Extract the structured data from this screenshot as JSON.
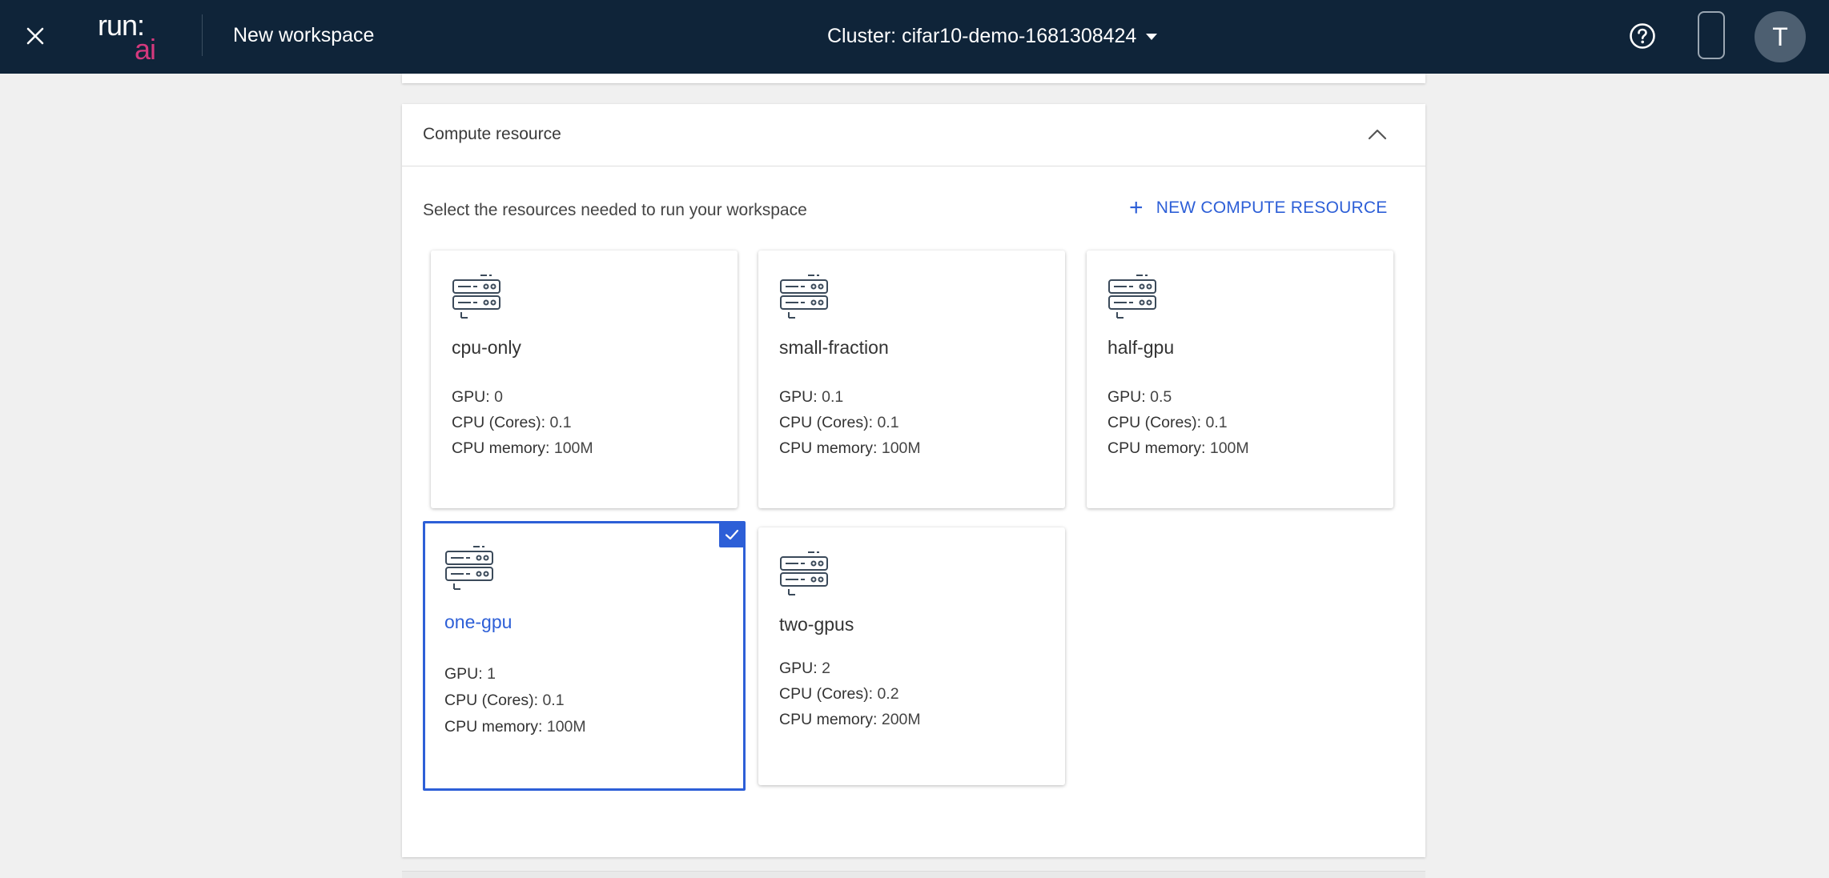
{
  "header": {
    "logo_top": "run:",
    "logo_bottom": "ai",
    "title": "New workspace",
    "cluster_label": "Cluster: cifar10-demo-1681308424",
    "avatar_initial": "T",
    "close_icon": "close-icon",
    "help_icon": "help-circle-icon"
  },
  "section": {
    "title": "Compute resource",
    "instruction": "Select the resources needed to run your workspace",
    "new_button": "NEW COMPUTE RESOURCE"
  },
  "cards": [
    {
      "name": "cpu-only",
      "gpu_label": "GPU:",
      "gpu": "0",
      "cpu_label": "CPU (Cores):",
      "cpu": "0.1",
      "mem_label": "CPU memory:",
      "mem": "100M",
      "selected": false
    },
    {
      "name": "small-fraction",
      "gpu_label": "GPU:",
      "gpu": "0.1",
      "cpu_label": "CPU (Cores):",
      "cpu": "0.1",
      "mem_label": "CPU memory:",
      "mem": "100M",
      "selected": false
    },
    {
      "name": "half-gpu",
      "gpu_label": "GPU:",
      "gpu": "0.5",
      "cpu_label": "CPU (Cores):",
      "cpu": "0.1",
      "mem_label": "CPU memory:",
      "mem": "100M",
      "selected": false
    },
    {
      "name": "one-gpu",
      "gpu_label": "GPU:",
      "gpu": "1",
      "cpu_label": "CPU (Cores):",
      "cpu": "0.1",
      "mem_label": "CPU memory:",
      "mem": "100M",
      "selected": true
    },
    {
      "name": "two-gpus",
      "gpu_label": "GPU:",
      "gpu": "2",
      "cpu_label": "CPU (Cores):",
      "cpu": "0.2",
      "mem_label": "CPU memory:",
      "mem": "200M",
      "selected": false
    }
  ],
  "colors": {
    "topbar": "#0f2439",
    "accent": "#2d5fd7",
    "logo_ai": "#d4397d"
  }
}
